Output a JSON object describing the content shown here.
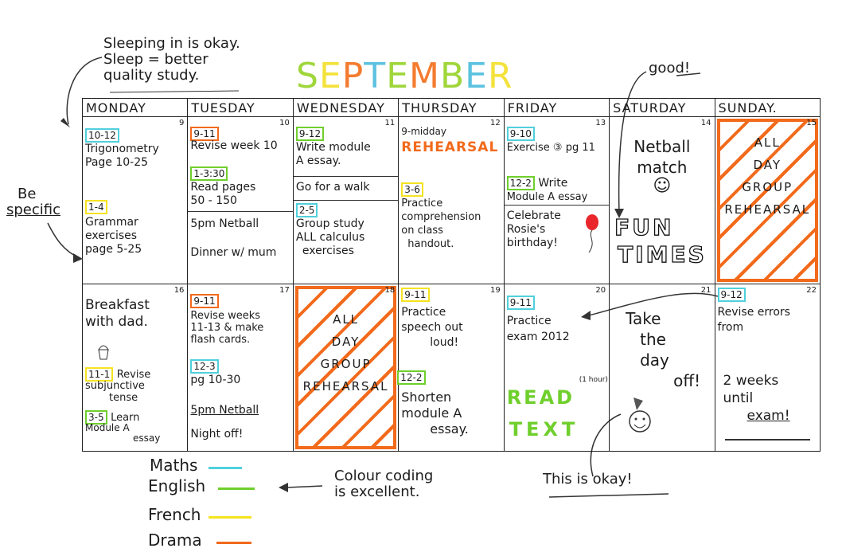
{
  "title_letters": [
    "S",
    "E",
    "P",
    "T",
    "E",
    "M",
    "B",
    "E",
    "R"
  ],
  "title_colors": [
    "#9fd63a",
    "#f4e23c",
    "#f47b2e",
    "#5cc2e0",
    "#9fd63a",
    "#f47b2e",
    "#9fd63a",
    "#5cc2e0",
    "#f4e23c"
  ],
  "colors": {
    "maths": "#4fd0dc",
    "english": "#6fcf2c",
    "french": "#f5e321",
    "drama": "#f26a1b"
  },
  "annotations": {
    "sleep": [
      "Sleeping in is okay.",
      "Sleep = better",
      "quality study."
    ],
    "specific": [
      "Be",
      "specific"
    ],
    "good": "good!",
    "colour": [
      "Colour coding",
      "is excellent."
    ],
    "okay": "This is okay!"
  },
  "days": [
    "MONDAY",
    "TUESDAY",
    "WEDNESDAY",
    "THURSDAY",
    "FRIDAY",
    "SATURDAY",
    "SUNDAY."
  ],
  "week1": {
    "mon": {
      "num": "9",
      "t1": "10-12",
      "l1": [
        "Trigonometry",
        "Page 10-25"
      ],
      "t2": "1-4",
      "l2": [
        "Grammar",
        "exercises",
        "page 5-25"
      ]
    },
    "tue": {
      "num": "10",
      "t1": "9-11",
      "l1": "Revise week 10",
      "t2": "1-3:30",
      "l2": [
        "Read pages",
        "50 - 150"
      ],
      "l3": "5pm Netball",
      "l4": "Dinner w/ mum"
    },
    "wed": {
      "num": "11",
      "t1": "9-12",
      "l1": [
        "Write module",
        "A essay."
      ],
      "l2": "Go for a walk",
      "t2": "2-5",
      "l3": [
        "Group study",
        "ALL calculus",
        "exercises"
      ]
    },
    "thu": {
      "num": "12",
      "l0": "9-midday",
      "l1": "REHEARSAL",
      "t2": "3-6",
      "l2": [
        "Practice",
        "comprehension",
        "on class",
        "handout."
      ]
    },
    "fri": {
      "num": "13",
      "t1": "9-10",
      "l1": "Exercise ③ pg 11",
      "t2": "12-2",
      "l2": "Write",
      "l2b": "Module A essay",
      "l3": [
        "Celebrate",
        "Rosie's",
        "birthday!"
      ]
    },
    "sat": {
      "num": "14",
      "l1": [
        "Netball",
        "match"
      ],
      "face": "☺",
      "l2": "FUN",
      "l3": "TIMES"
    },
    "sun": {
      "num": "15",
      "l1": [
        "ALL",
        "DAY",
        "GROUP",
        "REHEARSAL"
      ]
    }
  },
  "week2": {
    "mon": {
      "num": "16",
      "l1": [
        "Breakfast",
        "with dad."
      ],
      "t2": "11-1",
      "l2": "Revise",
      "l2b": [
        "subjunctive",
        "tense"
      ],
      "t3": "3-5",
      "l3": "Learn",
      "l3b": [
        "Module A",
        "essay"
      ]
    },
    "tue": {
      "num": "17",
      "t1": "9-11",
      "l1": [
        "Revise weeks",
        "11-13 & make",
        "flash cards."
      ],
      "t2": "12-3",
      "l2": "pg 10-30",
      "l3": "5pm Netball",
      "l4": "Night off!"
    },
    "wed": {
      "num": "18",
      "l1": [
        "ALL",
        "DAY",
        "GROUP",
        "REHEARSAL"
      ]
    },
    "thu": {
      "num": "19",
      "t1": "9-11",
      "l1": [
        "Practice",
        "speech out",
        "loud!"
      ],
      "t2": "12-2",
      "l2": [
        "Shorten",
        "module A",
        "essay."
      ]
    },
    "fri": {
      "num": "20",
      "t1": "9-11",
      "l1": [
        "Practice",
        "exam 2012"
      ],
      "l2": "READ",
      "l2s": "(1 hour)",
      "l3": "TEXT"
    },
    "sat": {
      "num": "21",
      "l1": [
        "Take",
        "the",
        "day",
        "off!"
      ]
    },
    "sun": {
      "num": "22",
      "t1": "9-12",
      "l1": [
        "Revise errors",
        "from"
      ],
      "l2": [
        "2 weeks",
        "until",
        "exam!"
      ]
    }
  },
  "legend": [
    "Maths",
    "English",
    "French",
    "Drama"
  ]
}
